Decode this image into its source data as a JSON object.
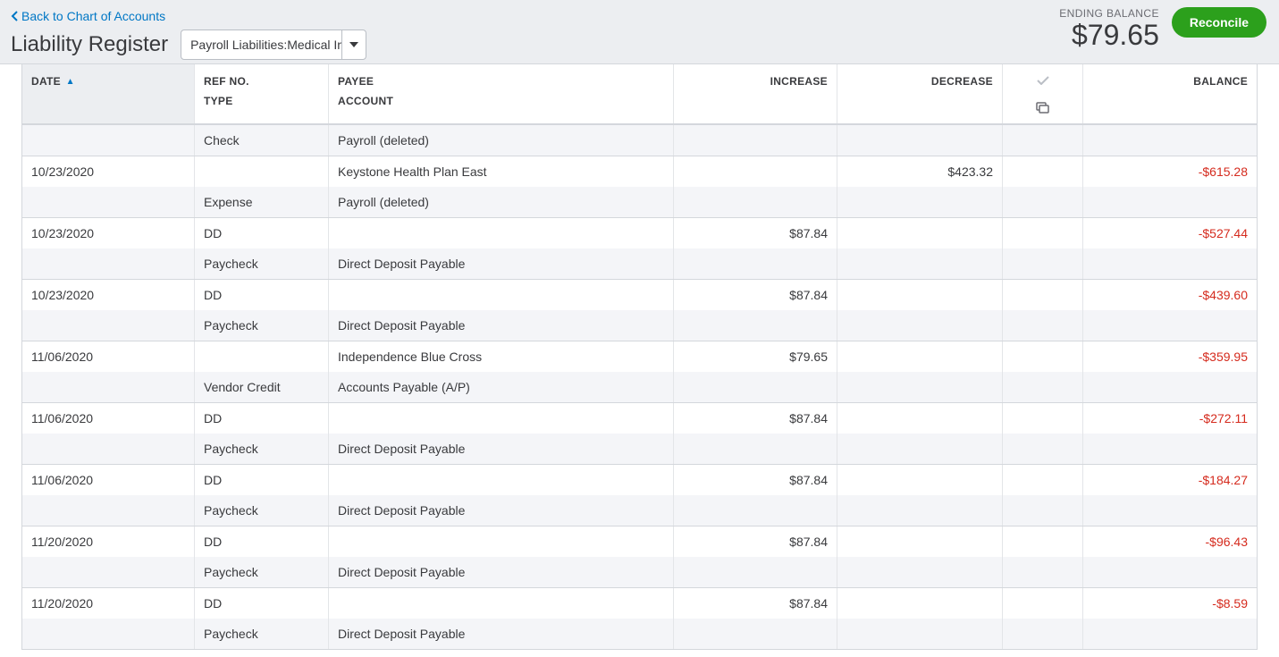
{
  "header": {
    "back_label": "Back to Chart of Accounts",
    "page_title": "Liability Register",
    "account_selected": "Payroll Liabilities:Medical In",
    "ending_balance_label": "ENDING BALANCE",
    "ending_balance_amount": "$79.65",
    "reconcile_label": "Reconcile"
  },
  "columns": {
    "date": "DATE",
    "ref": "REF NO.",
    "type": "TYPE",
    "payee": "PAYEE",
    "account": "ACCOUNT",
    "increase": "INCREASE",
    "decrease": "DECREASE",
    "balance": "BALANCE"
  },
  "entries": [
    {
      "first_partial": true,
      "date": "",
      "ref": "",
      "type": "Check",
      "payee": "",
      "account": "Payroll (deleted)",
      "increase": "",
      "decrease": "",
      "balance": "",
      "balance_neg": false
    },
    {
      "date": "10/23/2020",
      "ref": "",
      "type": "Expense",
      "payee": "Keystone Health Plan East",
      "account": "Payroll (deleted)",
      "increase": "",
      "decrease": "$423.32",
      "balance": "-$615.28",
      "balance_neg": true
    },
    {
      "date": "10/23/2020",
      "ref": "DD",
      "type": "Paycheck",
      "payee": "",
      "account": "Direct Deposit Payable",
      "increase": "$87.84",
      "decrease": "",
      "balance": "-$527.44",
      "balance_neg": true
    },
    {
      "date": "10/23/2020",
      "ref": "DD",
      "type": "Paycheck",
      "payee": "",
      "account": "Direct Deposit Payable",
      "increase": "$87.84",
      "decrease": "",
      "balance": "-$439.60",
      "balance_neg": true
    },
    {
      "date": "11/06/2020",
      "ref": "",
      "type": "Vendor Credit",
      "payee": "Independence Blue Cross",
      "account": "Accounts Payable (A/P)",
      "increase": "$79.65",
      "decrease": "",
      "balance": "-$359.95",
      "balance_neg": true
    },
    {
      "date": "11/06/2020",
      "ref": "DD",
      "type": "Paycheck",
      "payee": "",
      "account": "Direct Deposit Payable",
      "increase": "$87.84",
      "decrease": "",
      "balance": "-$272.11",
      "balance_neg": true
    },
    {
      "date": "11/06/2020",
      "ref": "DD",
      "type": "Paycheck",
      "payee": "",
      "account": "Direct Deposit Payable",
      "increase": "$87.84",
      "decrease": "",
      "balance": "-$184.27",
      "balance_neg": true
    },
    {
      "date": "11/20/2020",
      "ref": "DD",
      "type": "Paycheck",
      "payee": "",
      "account": "Direct Deposit Payable",
      "increase": "$87.84",
      "decrease": "",
      "balance": "-$96.43",
      "balance_neg": true
    },
    {
      "date": "11/20/2020",
      "ref": "DD",
      "type": "Paycheck",
      "payee": "",
      "account": "Direct Deposit Payable",
      "increase": "$87.84",
      "decrease": "",
      "balance": "-$8.59",
      "balance_neg": true
    }
  ]
}
